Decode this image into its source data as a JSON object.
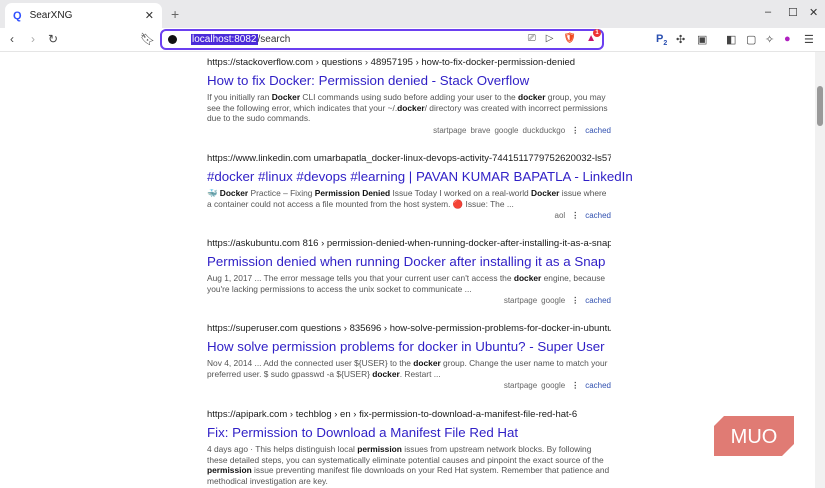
{
  "tab": {
    "title": "SearXNG"
  },
  "address": {
    "host": "localhost:8082",
    "path": "/search"
  },
  "results": [
    {
      "url": "https://stackoverflow.com  › questions › 48957195 › how-to-fix-docker-permission-denied",
      "title": "How to fix Docker: Permission denied - Stack Overflow",
      "snippet": [
        {
          "t": "If you initially ran "
        },
        {
          "t": "Docker",
          "b": true
        },
        {
          "t": " CLI commands using sudo before adding your user to the "
        },
        {
          "t": "docker",
          "b": true
        },
        {
          "t": " group, you may see the following error, which indicates that your ~/."
        },
        {
          "t": "docker",
          "b": true
        },
        {
          "t": "/ directory was created with incorrect permissions due to the sudo commands."
        }
      ],
      "engines": [
        "startpage",
        "brave",
        "google",
        "duckduckgo"
      ]
    },
    {
      "url": "https://www.linkedin.com  umarbapatla_docker-linux-devops-activity-7441511779752620032-ls57",
      "title": "#docker #linux #devops #learning | PAVAN KUMAR BAPATLA - LinkedIn",
      "snippet": [
        {
          "t": "🐳 "
        },
        {
          "t": "Docker",
          "b": true
        },
        {
          "t": " Practice – Fixing "
        },
        {
          "t": "Permission Denied",
          "b": true
        },
        {
          "t": " Issue Today I worked on a real-world "
        },
        {
          "t": "Docker",
          "b": true
        },
        {
          "t": " issue where a container could not access a file mounted from the host system. 🔴 Issue: The ..."
        }
      ],
      "engines": [
        "aol"
      ]
    },
    {
      "url": "https://askubuntu.com  816 › permission-denied-when-running-docker-after-installing-it-as-a-snap",
      "title": "Permission denied when running Docker after installing it as a Snap",
      "snippet": [
        {
          "t": "Aug 1, 2017 ... The error message tells you that your current user can't access the "
        },
        {
          "t": "docker",
          "b": true
        },
        {
          "t": " engine, because you're lacking permissions to access the unix socket to communicate ..."
        }
      ],
      "engines": [
        "startpage",
        "google"
      ]
    },
    {
      "url": "https://superuser.com  questions › 835696 › how-solve-permission-problems-for-docker-in-ubuntu",
      "title": "How solve permission problems for docker in Ubuntu? - Super User",
      "snippet": [
        {
          "t": "Nov 4, 2014 ... Add the connected user ${USER} to the "
        },
        {
          "t": "docker",
          "b": true
        },
        {
          "t": " group. Change the user name to match your preferred user. $ sudo gpasswd -a ${USER} "
        },
        {
          "t": "docker",
          "b": true
        },
        {
          "t": ". Restart ..."
        }
      ],
      "engines": [
        "startpage",
        "google"
      ]
    },
    {
      "url": "https://apipark.com  › techblog › en › fix-permission-to-download-a-manifest-file-red-hat-6",
      "title": "Fix: Permission to Download a Manifest File Red Hat",
      "snippet": [
        {
          "t": "4 days ago · This helps distinguish local "
        },
        {
          "t": "permission",
          "b": true
        },
        {
          "t": " issues from upstream network blocks. By following these detailed steps, you can systematically eliminate potential causes and pinpoint the exact source of the "
        },
        {
          "t": "permission",
          "b": true
        },
        {
          "t": " issue preventing manifest file downloads on your Red Hat system. Remember that patience and methodical investigation are key."
        }
      ],
      "engines": []
    }
  ],
  "cached_label": "cached",
  "watermark": "MUO",
  "badges": {
    "bat": "1",
    "ext": "2"
  }
}
